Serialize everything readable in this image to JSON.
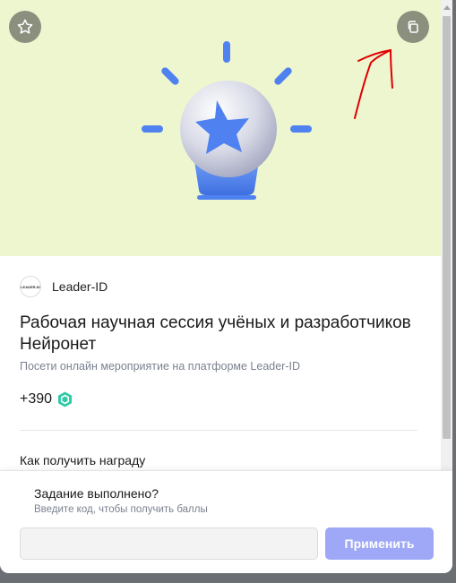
{
  "hero": {
    "favorite_icon": "star-outline-icon",
    "copy_icon": "copy-icon",
    "illustration": "lightbulb-star-illustration",
    "colors": {
      "background": "#eef6cf",
      "bulb_accent": "#4f82f0",
      "annotation": "#e00000"
    }
  },
  "organizer": {
    "logo_text": "LEADER-ID",
    "name": "Leader-ID"
  },
  "task": {
    "title": "Рабочая научная сессия учёных и разработчиков Нейронет",
    "subtitle": "Посети онлайн мероприятие на платформе Leader-ID",
    "reward": "+390",
    "reward_icon": "hexagon-coin-icon",
    "reward_color": "#2fc9a5"
  },
  "section": {
    "howto_label": "Как получить награду"
  },
  "footer": {
    "question": "Задание выполнено?",
    "hint": "Введите код, чтобы получить баллы",
    "input_value": "",
    "input_placeholder": "",
    "apply_label": "Применить",
    "apply_color": "#9ea8f7"
  }
}
